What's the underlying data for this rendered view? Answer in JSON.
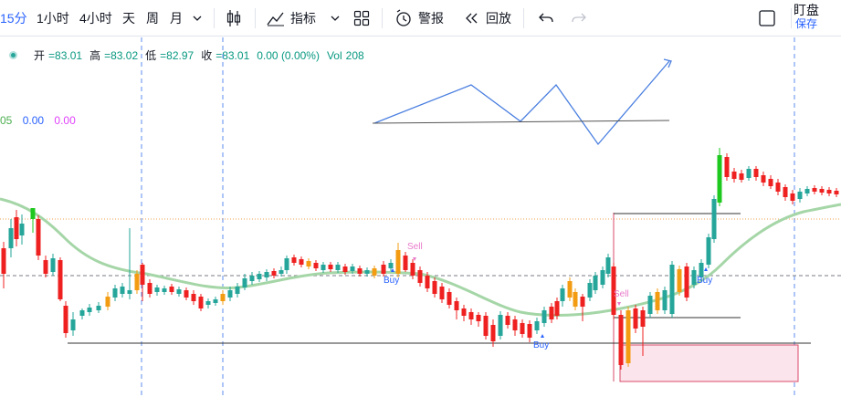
{
  "toolbar": {
    "intervals": [
      "15分",
      "1小时",
      "4小时",
      "天",
      "周",
      "月"
    ],
    "active_interval": "15分",
    "indicators_label": "指标",
    "alert_label": "警报",
    "replay_label": "回放",
    "watch_label": "盯盘",
    "save_label": "保存"
  },
  "legend": {
    "open_label": "开",
    "open_value": "=83.01",
    "high_label": "高",
    "high_value": "=83.02",
    "low_label": "低",
    "low_value": "=82.97",
    "close_label": "收",
    "close_value": "=83.01",
    "change": "0.00 (0.00%)",
    "volume_label": "Vol",
    "volume_value": "208"
  },
  "indicator_values": {
    "v1": "05",
    "v2": "0.00",
    "v3": "0.00",
    "v1_color": "#4caf50",
    "v2_color": "#2962ff",
    "v3_color": "#e040fb"
  },
  "signals": {
    "sell_1": "Sell",
    "buy_1": "Buy",
    "buy_2": "Buy",
    "sell_2": "Sell",
    "buy_3": "Buy"
  },
  "colors": {
    "up": "#26a69a",
    "up_bright": "#1ec81e",
    "down": "#ef2020",
    "ma": "#a5d6a7",
    "accent": "#2962ff",
    "box": "#f8bbd0"
  }
}
